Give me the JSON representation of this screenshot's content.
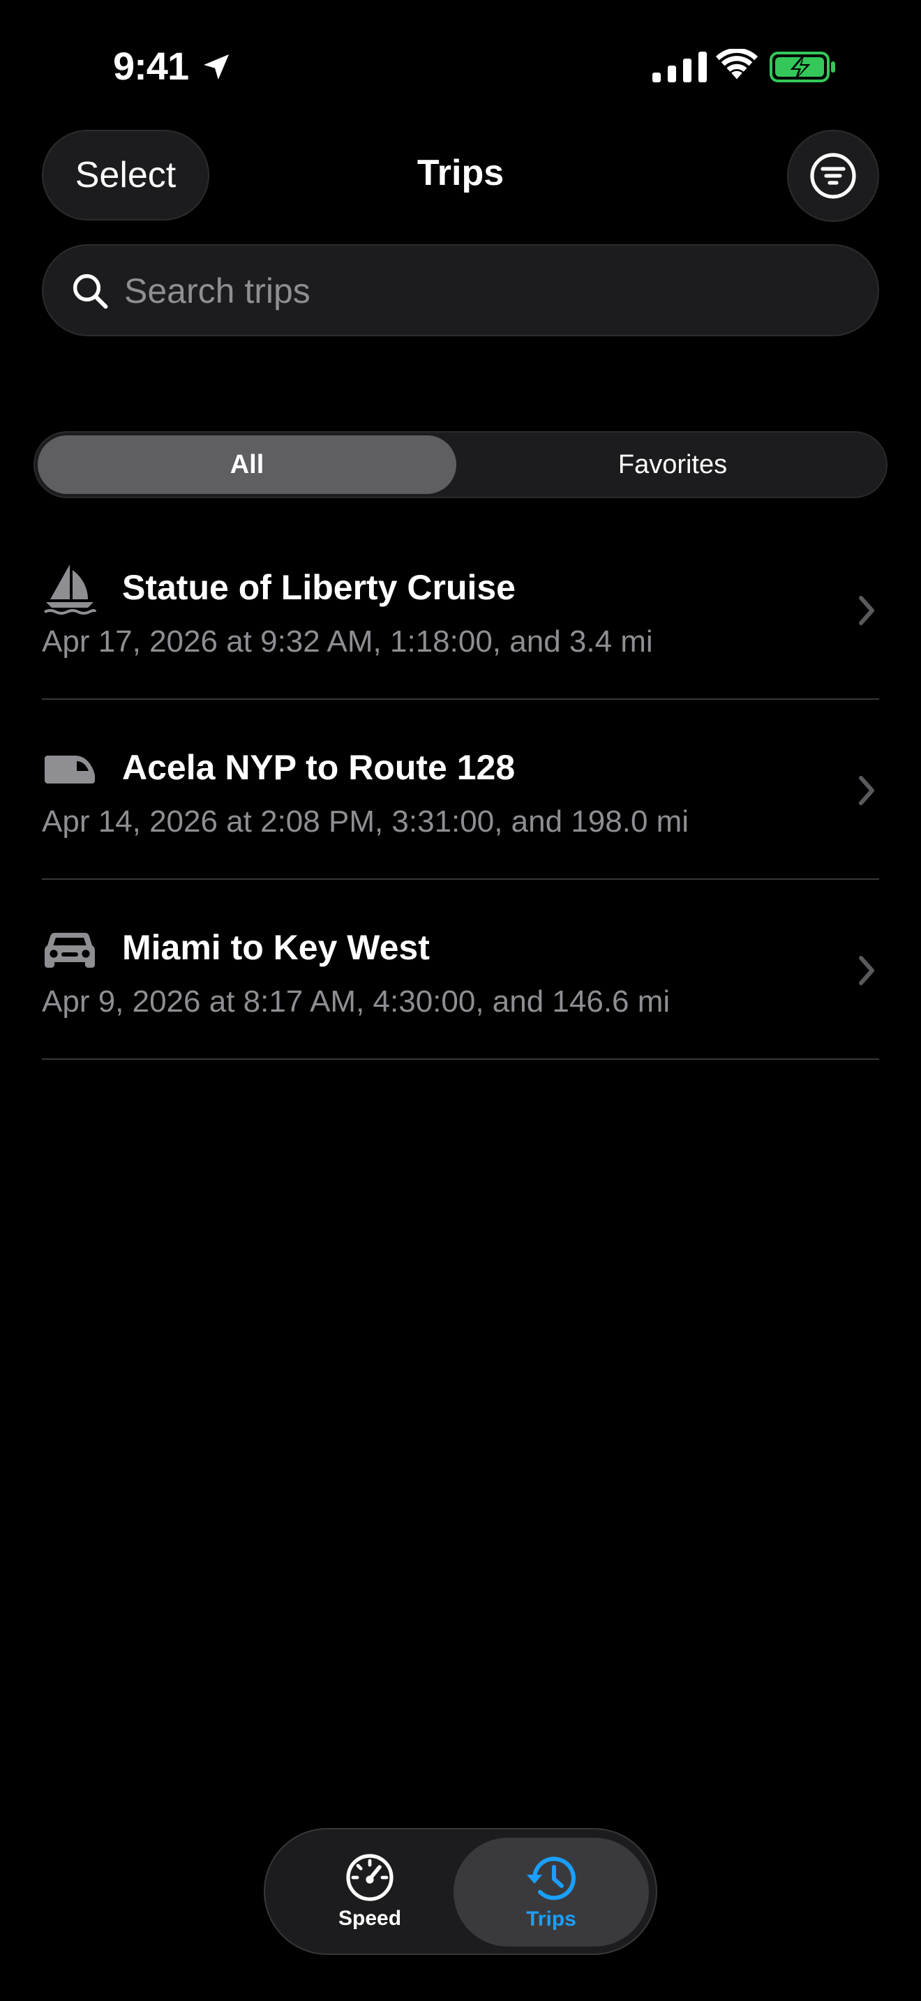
{
  "status_bar": {
    "time": "9:41",
    "battery_color": "#34c759"
  },
  "header": {
    "select_label": "Select",
    "title": "Trips",
    "filter_icon": "filter-circle-icon"
  },
  "search": {
    "placeholder": "Search trips",
    "value": ""
  },
  "segments": {
    "all_label": "All",
    "favorites_label": "Favorites",
    "selected": "All"
  },
  "trips": [
    {
      "icon": "sailboat-icon",
      "title": "Statue of Liberty Cruise",
      "subtitle": "Apr 17, 2026 at 9:32 AM, 1:18:00, and 3.4 mi"
    },
    {
      "icon": "train-icon",
      "title": "Acela NYP to Route 128",
      "subtitle": "Apr 14, 2026 at 2:08 PM, 3:31:00, and 198.0 mi"
    },
    {
      "icon": "car-icon",
      "title": "Miami to Key West",
      "subtitle": "Apr 9, 2026 at 8:17 AM, 4:30:00, and 146.6 mi"
    }
  ],
  "tab_bar": {
    "speed_label": "Speed",
    "trips_label": "Trips",
    "selected": "Trips",
    "accent_color": "#1a9fff"
  }
}
